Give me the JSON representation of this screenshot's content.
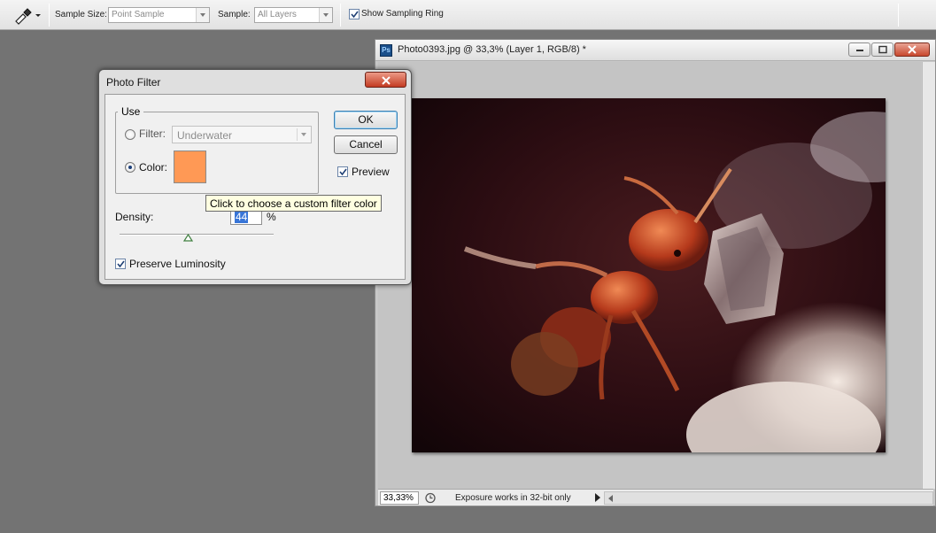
{
  "options_bar": {
    "tool_icon": "eyedropper-icon",
    "sample_size_label": "Sample Size:",
    "sample_size_value": "Point Sample",
    "sample_label": "Sample:",
    "sample_value": "All Layers",
    "show_sampling_ring_label": "Show Sampling Ring",
    "show_sampling_ring_checked": true
  },
  "document": {
    "title": "Photo0393.jpg @ 33,3% (Layer 1, RGB/8) *",
    "app_icon_text": "Ps",
    "zoom": "33,33%",
    "status_text": "Exposure works in 32-bit only"
  },
  "dialog": {
    "title": "Photo Filter",
    "use_group_label": "Use",
    "filter_label": "Filter:",
    "filter_value": "Underwater",
    "color_label": "Color:",
    "selected_option": "color",
    "filter_color": "#ff9955",
    "tooltip": "Click to choose a custom filter color",
    "density_label": "Density:",
    "density_value": "44",
    "density_unit": "%",
    "density_percent": 44,
    "preserve_luminosity_label": "Preserve Luminosity",
    "preserve_luminosity_checked": true,
    "ok_label": "OK",
    "cancel_label": "Cancel",
    "preview_label": "Preview",
    "preview_checked": true
  }
}
